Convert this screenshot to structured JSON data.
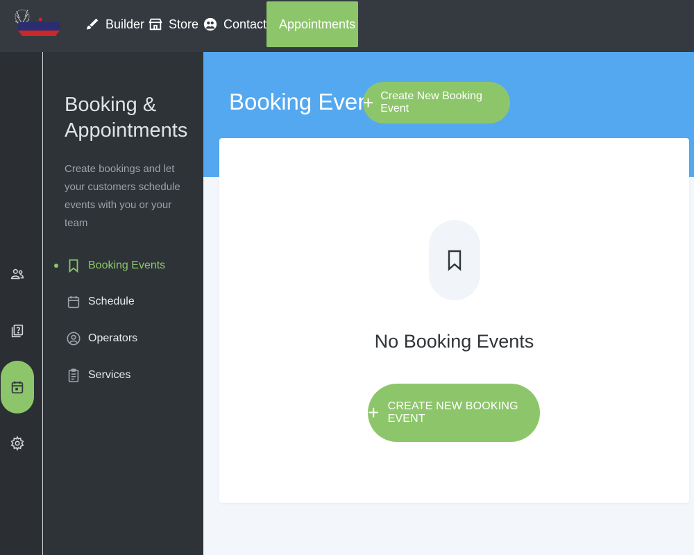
{
  "topnav": {
    "items": [
      {
        "label": "Builder",
        "icon": "brush-icon"
      },
      {
        "label": "Store",
        "icon": "store-icon"
      },
      {
        "label": "Contacts",
        "icon": "contacts-icon"
      },
      {
        "label": "Appointments",
        "icon": "calendar-icon",
        "active": true
      }
    ]
  },
  "rail": {
    "items": [
      {
        "icon": "users-icon"
      },
      {
        "icon": "help-book-icon"
      },
      {
        "icon": "calendar-icon",
        "active": true
      },
      {
        "icon": "gear-icon"
      }
    ]
  },
  "sidebar": {
    "title": "Booking & Appointments",
    "description": "Create bookings and let your customers schedule events with you or your team",
    "menu": [
      {
        "label": "Booking Events",
        "icon": "bookmark-icon",
        "active": true
      },
      {
        "label": "Schedule",
        "icon": "calendar-icon"
      },
      {
        "label": "Operators",
        "icon": "user-circle-icon"
      },
      {
        "label": "Services",
        "icon": "clipboard-icon"
      }
    ]
  },
  "main": {
    "title": "Booking Events",
    "create_button": "Create New Booking Event",
    "empty": {
      "title": "No Booking Events",
      "button": "CREATE NEW BOOKING EVENT"
    }
  },
  "colors": {
    "accent_green": "#8dc66a",
    "banner_blue": "#54a8ef",
    "topbar": "#343a40",
    "sidebar": "#2e3338"
  }
}
